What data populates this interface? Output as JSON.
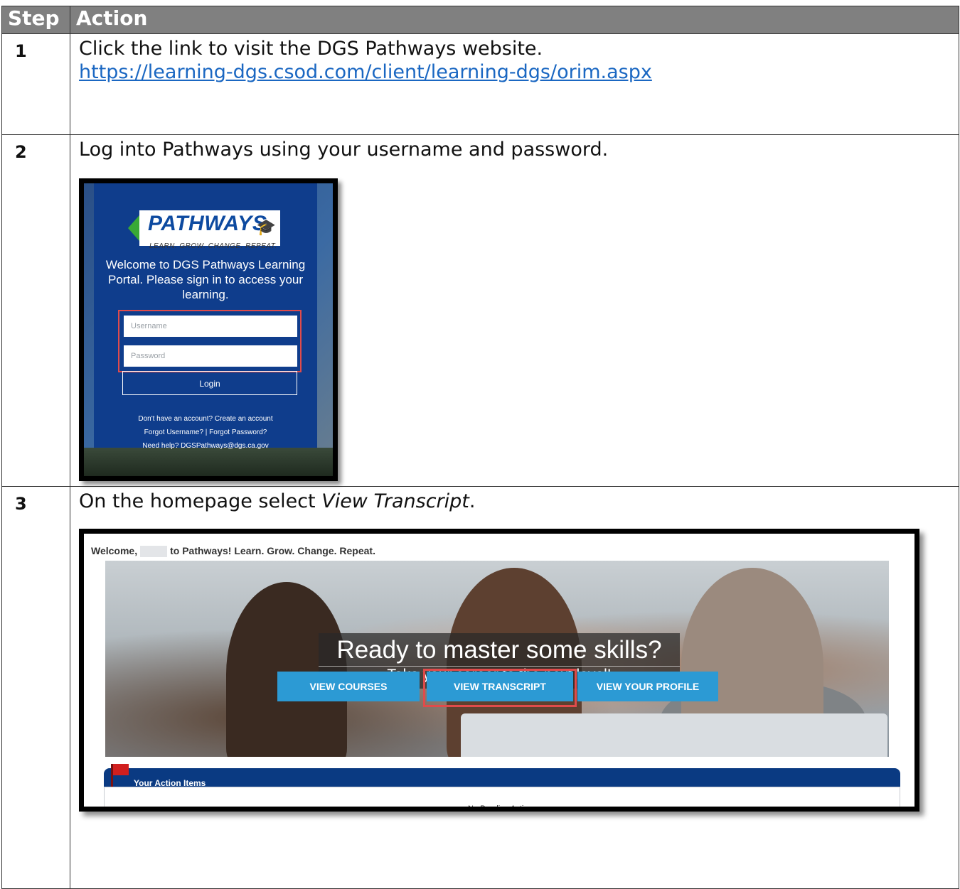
{
  "table": {
    "headers": [
      "Step",
      "Action"
    ]
  },
  "steps": [
    {
      "number": "1",
      "text": "Click the link to visit the DGS Pathways website.",
      "link": "https://learning-dgs.csod.com/client/learning-dgs/orim.aspx"
    },
    {
      "number": "2",
      "text": "Log into Pathways using your username and password."
    },
    {
      "number": "3",
      "text_before": "On the homepage select ",
      "text_italic": "View Transcript",
      "text_after": "."
    }
  ],
  "login_screenshot": {
    "logo_word": "PATHWAYS",
    "logo_tagline": "LEARN. GROW. CHANGE. REPEAT.",
    "welcome": "Welcome to DGS Pathways Learning Portal. Please sign in to access your learning.",
    "username_placeholder": "Username",
    "password_placeholder": "Password",
    "login_button": "Login",
    "create_account": "Don't have an account? Create an account",
    "forgot": "Forgot Username? | Forgot Password?",
    "help": "Need help? DGSPathways@dgs.ca.gov",
    "highlight_color": "#e04b4b",
    "panel_color": "#0f3d8c"
  },
  "home_screenshot": {
    "welcome_prefix": "Welcome,",
    "welcome_suffix": "to Pathways! Learn. Grow. Change. Repeat.",
    "headline": "Ready to master some skills?",
    "subheadline": "Take your career to the next level!",
    "buttons": [
      "VIEW COURSES",
      "VIEW TRANSCRIPT",
      "VIEW YOUR PROFILE"
    ],
    "action_items_title": "Your Action Items",
    "no_pending": "No Pending Actions",
    "button_color": "#2c9ad4",
    "highlight_color": "#e04b4b"
  }
}
